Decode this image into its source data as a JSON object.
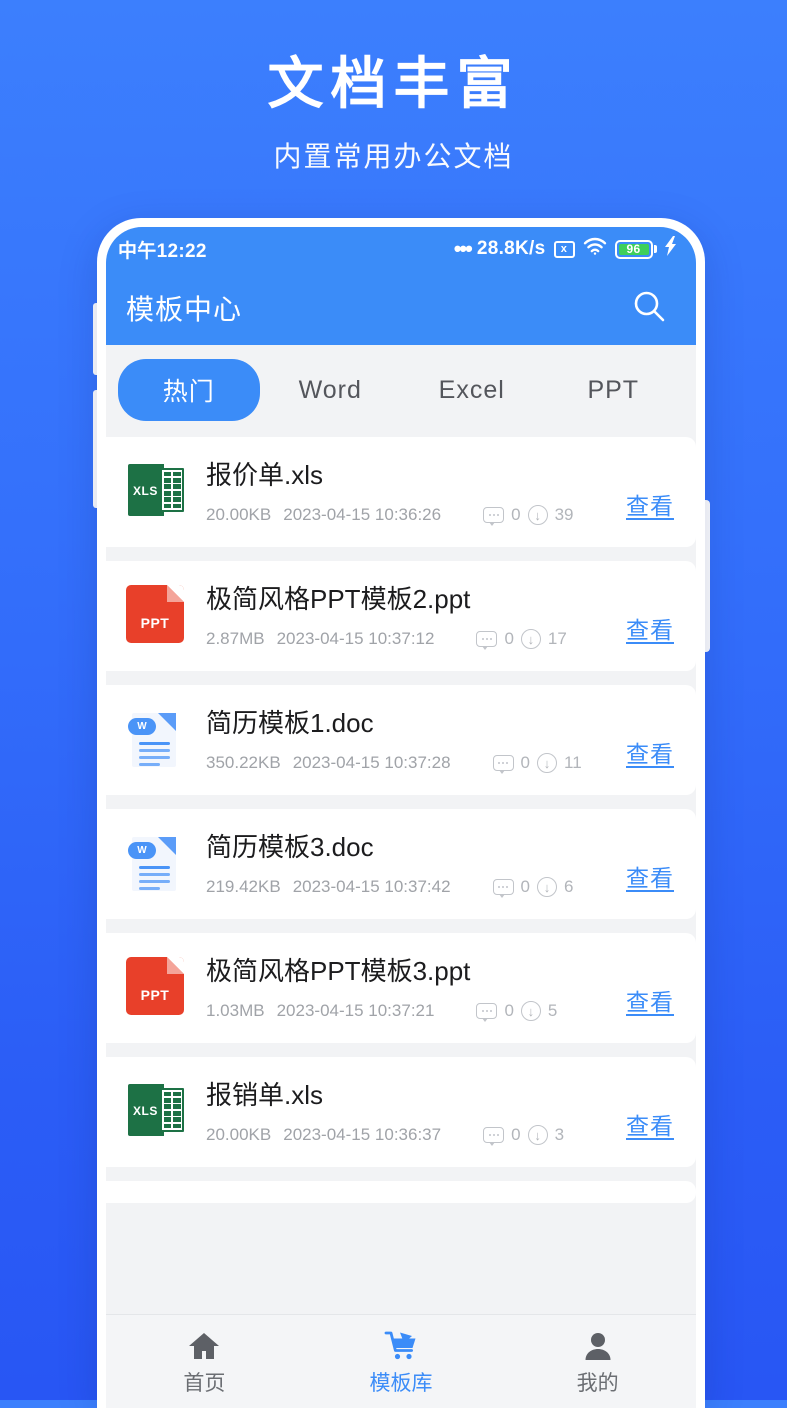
{
  "promo": {
    "title": "文档丰富",
    "subtitle": "内置常用办公文档"
  },
  "theme": {
    "bg_top": "#3c7ffd",
    "bg_bottom": "#2856f4",
    "accent": "#3b8cf8",
    "accent_link": "#3b8cf8",
    "screen_bg": "#f2f3f5",
    "xls_color": "#1d7145",
    "ppt_color": "#e8402a",
    "doc_color": "#4a94f7"
  },
  "statusbar": {
    "time": "中午12:22",
    "net_dots": "•••",
    "net_speed": "28.8K/s",
    "signal_x_icon": "x-signal-icon",
    "signal_x_label": "x",
    "wifi_icon": "wifi-icon",
    "battery_level": "96",
    "battery_icon": "battery-icon",
    "charging_icon": "charging-bolt-icon"
  },
  "appbar": {
    "title": "模板中心",
    "search_icon": "search-icon"
  },
  "tabs": [
    {
      "label": "热门",
      "active": true
    },
    {
      "label": "Word",
      "active": false
    },
    {
      "label": "Excel",
      "active": false
    },
    {
      "label": "PPT",
      "active": false
    }
  ],
  "list": {
    "action_label": "查看",
    "items": [
      {
        "icon": "xls",
        "icon_label": "XLS",
        "name": "报价单.xls",
        "size": "20.00KB",
        "date": "2023-04-15 10:36:26",
        "comments": "0",
        "downloads": "39",
        "action": "查看"
      },
      {
        "icon": "ppt",
        "icon_label": "PPT",
        "name": "极简风格PPT模板2.ppt",
        "size": "2.87MB",
        "date": "2023-04-15 10:37:12",
        "comments": "0",
        "downloads": "17",
        "action": "查看"
      },
      {
        "icon": "doc",
        "icon_label": "W",
        "name": "简历模板1.doc",
        "size": "350.22KB",
        "date": "2023-04-15 10:37:28",
        "comments": "0",
        "downloads": "11",
        "action": "查看"
      },
      {
        "icon": "doc",
        "icon_label": "W",
        "name": "简历模板3.doc",
        "size": "219.42KB",
        "date": "2023-04-15 10:37:42",
        "comments": "0",
        "downloads": "6",
        "action": "查看"
      },
      {
        "icon": "ppt",
        "icon_label": "PPT",
        "name": "极简风格PPT模板3.ppt",
        "size": "1.03MB",
        "date": "2023-04-15 10:37:21",
        "comments": "0",
        "downloads": "5",
        "action": "查看"
      },
      {
        "icon": "xls",
        "icon_label": "XLS",
        "name": "报销单.xls",
        "size": "20.00KB",
        "date": "2023-04-15 10:36:37",
        "comments": "0",
        "downloads": "3",
        "action": "查看"
      }
    ]
  },
  "bottomnav": [
    {
      "label": "首页",
      "icon": "home-icon",
      "active": false
    },
    {
      "label": "模板库",
      "icon": "cart-icon",
      "active": true
    },
    {
      "label": "我的",
      "icon": "person-icon",
      "active": false
    }
  ]
}
